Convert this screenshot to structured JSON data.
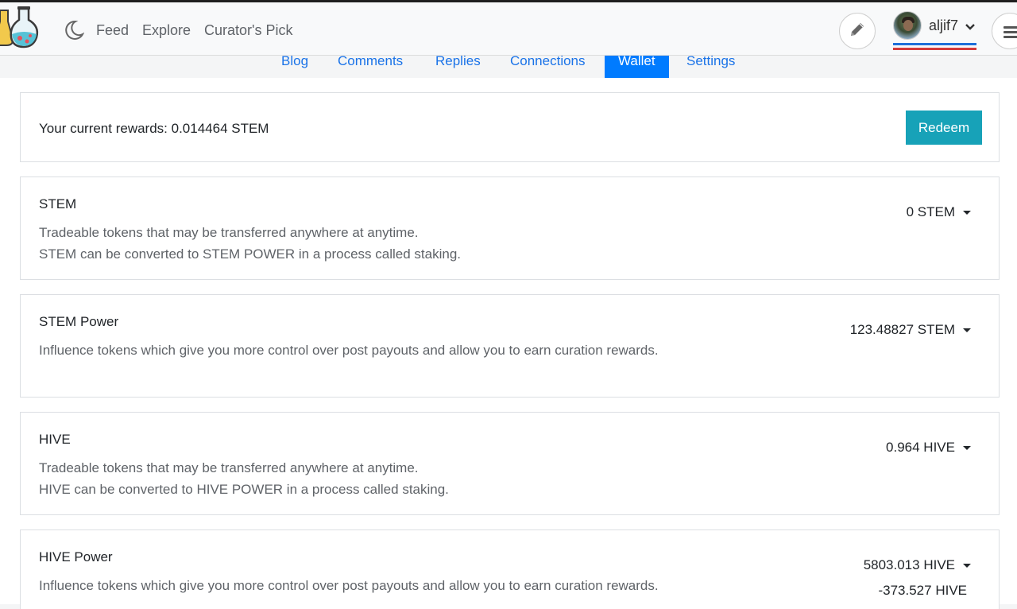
{
  "nav": {
    "feed": "Feed",
    "explore": "Explore",
    "curators_pick": "Curator's Pick"
  },
  "user": {
    "name": "aljif7"
  },
  "tabs": [
    {
      "label": "Blog"
    },
    {
      "label": "Comments"
    },
    {
      "label": "Replies"
    },
    {
      "label": "Connections"
    },
    {
      "label": "Wallet",
      "active": true
    },
    {
      "label": "Settings"
    }
  ],
  "rewards": {
    "text": "Your current rewards: 0.014464 STEM",
    "redeem_label": "Redeem"
  },
  "wallets": [
    {
      "title": "STEM",
      "desc_line1": "Tradeable tokens that may be transferred anywhere at anytime.",
      "desc_line2": "STEM can be converted to STEM POWER in a process called staking.",
      "amount": "0 STEM"
    },
    {
      "title": "STEM Power",
      "desc_line1": "Influence tokens which give you more control over post payouts and allow you to earn curation rewards.",
      "amount": "123.48827 STEM"
    },
    {
      "title": "HIVE",
      "desc_line1": "Tradeable tokens that may be transferred anywhere at anytime.",
      "desc_line2": "HIVE can be converted to HIVE POWER in a process called staking.",
      "amount": "0.964 HIVE"
    },
    {
      "title": "HIVE Power",
      "desc_line1": "Influence tokens which give you more control over post payouts and allow you to earn curation rewards.",
      "amount": "5803.013 HIVE",
      "amount_delegated": "-373.527 HIVE"
    }
  ],
  "colors": {
    "accent": "#007bff",
    "redeem": "#17a2b8",
    "link": "#1a73e8"
  }
}
